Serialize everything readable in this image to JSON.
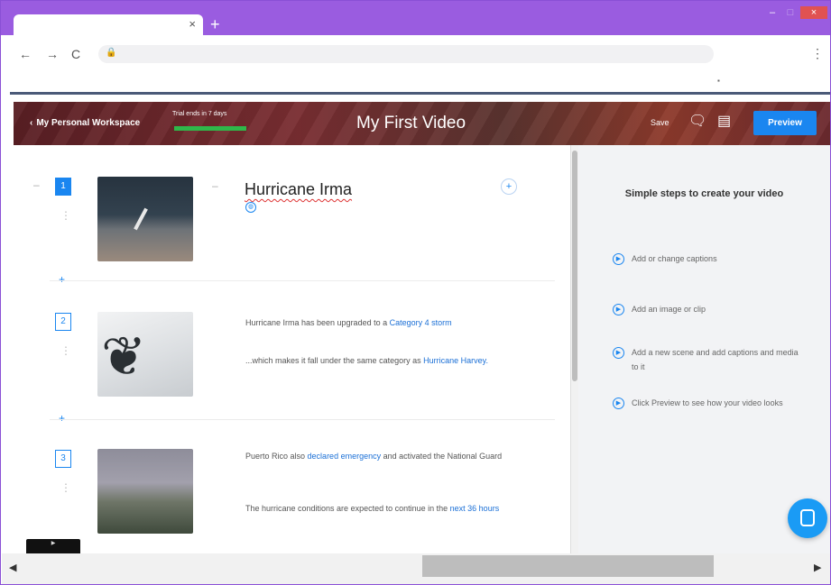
{
  "browser": {
    "tab_close": "×",
    "new_tab": "+",
    "window_controls": {
      "minimize": "–",
      "maximize": "□",
      "close": "×"
    },
    "nav": {
      "back": "←",
      "forward": "→",
      "reload": "C"
    },
    "lock_icon": "🔒",
    "menu": "⋮",
    "extension": "▪"
  },
  "header": {
    "workspace_label": "My Personal Workspace",
    "back_chevron": "‹",
    "trial_text": "Trial ends in 7 days",
    "title": "My First Video",
    "save_label": "Save",
    "comment_icon": "🗨",
    "folder_icon": "▤",
    "preview_label": "Preview"
  },
  "scenes": [
    {
      "number": "1",
      "title": "Hurricane Irma",
      "globe_icon": "◍"
    },
    {
      "number": "2",
      "captions": [
        {
          "text": "Hurricane Irma has been upgraded to a ",
          "link": "Category 4 storm"
        },
        {
          "text": "...which makes it fall under the same category as ",
          "link": "Hurricane Harvey."
        }
      ]
    },
    {
      "number": "3",
      "captions": [
        {
          "text": "Puerto Rico also ",
          "link": "declared emergency",
          "after": " and activated the National Guard"
        },
        {
          "text": "The hurricane conditions are expected to continue in the ",
          "link": "next 36 hours"
        }
      ]
    }
  ],
  "scene_controls": {
    "dash": "–",
    "add": "+",
    "handle": "⋮",
    "scene_add": "+"
  },
  "tv_thumb": "▶",
  "help": {
    "title": "Simple steps to create your video",
    "steps": [
      "Add or change captions",
      "Add an image or clip",
      "Add a new scene and add captions and media to it",
      "Click Preview to see how your video looks"
    ],
    "step_icon": "▶"
  },
  "scrollbar": {
    "left_arrow": "◀",
    "right_arrow": "▶"
  },
  "colors": {
    "accent": "#1a86f0",
    "browser_frame": "#9a5ce0",
    "trial_bar": "#2fb84a"
  }
}
